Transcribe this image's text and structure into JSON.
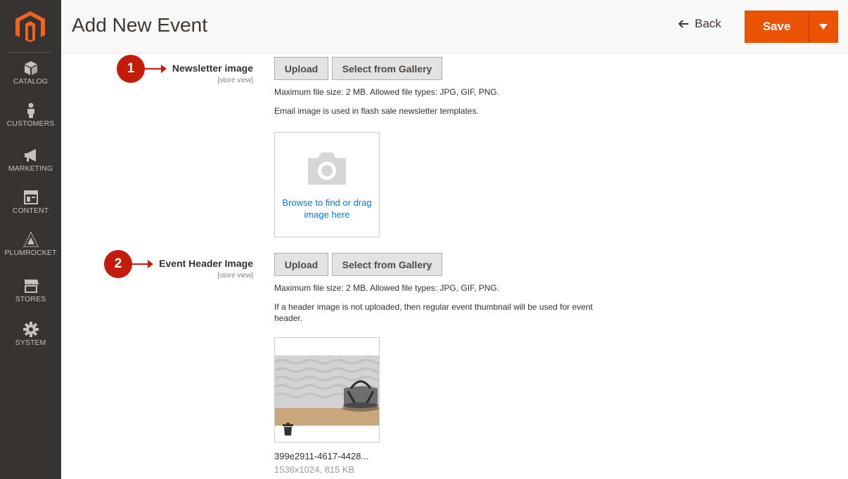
{
  "sidebar": {
    "logo_icon": "magento-logo-icon",
    "items": [
      {
        "label": "CATALOG",
        "icon": "cube-icon"
      },
      {
        "label": "CUSTOMERS",
        "icon": "person-icon"
      },
      {
        "label": "MARKETING",
        "icon": "megaphone-icon"
      },
      {
        "label": "CONTENT",
        "icon": "layout-icon"
      },
      {
        "label": "PLUMROCKET",
        "icon": "plumrocket-icon"
      },
      {
        "label": "STORES",
        "icon": "store-icon"
      },
      {
        "label": "SYSTEM",
        "icon": "gear-icon"
      }
    ]
  },
  "header": {
    "title": "Add New Event",
    "back_label": "Back",
    "save_label": "Save"
  },
  "fields": [
    {
      "marker": "1",
      "label": "Newsletter image",
      "scope": "[store view]",
      "upload_label": "Upload",
      "gallery_label": "Select from Gallery",
      "notes": [
        "Maximum file size: 2 MB. Allowed file types: JPG, GIF, PNG.",
        "Email image is used in flash sale newsletter templates."
      ],
      "dropzone_text": "Browse to find or drag image here"
    },
    {
      "marker": "2",
      "label": "Event Header Image",
      "scope": "[store view]",
      "upload_label": "Upload",
      "gallery_label": "Select from Gallery",
      "notes": [
        "Maximum file size: 2 MB. Allowed file types: JPG, GIF, PNG.",
        "If a header image is not uploaded, then regular event thumbnail will be used for event header."
      ],
      "file_name": "399e2911-4617-4428...",
      "file_meta": "1536x1024, 815 KB"
    }
  ],
  "colors": {
    "accent": "#eb5202",
    "sidebar_bg": "#373330",
    "marker": "#c41c0b",
    "link": "#007bdb"
  }
}
